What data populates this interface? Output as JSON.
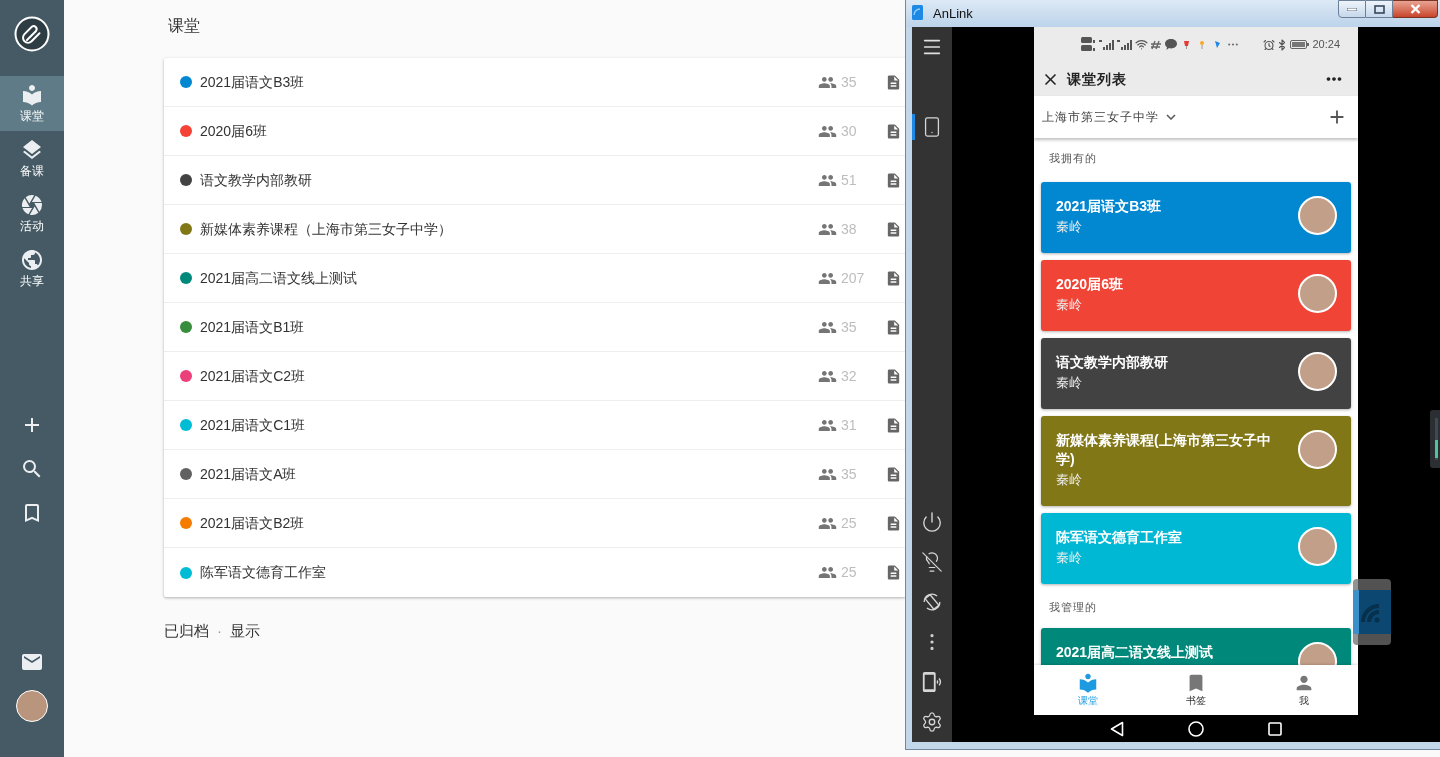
{
  "sidebar": {
    "items": [
      {
        "kind": "classes",
        "label": "课堂",
        "selected": true
      },
      {
        "kind": "lessons",
        "label": "备课",
        "selected": false
      },
      {
        "kind": "activities",
        "label": "活动",
        "selected": false
      },
      {
        "kind": "shared",
        "label": "共享",
        "selected": false
      }
    ]
  },
  "main": {
    "title": "课堂",
    "classes": [
      {
        "name": "2021届语文B3班",
        "color": "#0288d1",
        "members": "35"
      },
      {
        "name": "2020届6班",
        "color": "#f44336",
        "members": "30"
      },
      {
        "name": "语文教学内部教研",
        "color": "#424242",
        "members": "51"
      },
      {
        "name": "新媒体素养课程（上海市第三女子中学）",
        "color": "#827717",
        "members": "38"
      },
      {
        "name": "2021届高二语文线上测试",
        "color": "#00897b",
        "members": "207"
      },
      {
        "name": "2021届语文B1班",
        "color": "#388e3c",
        "members": "35"
      },
      {
        "name": "2021届语文C2班",
        "color": "#ec407a",
        "members": "32"
      },
      {
        "name": "2021届语文C1班",
        "color": "#00bcd4",
        "members": "31"
      },
      {
        "name": "2021届语文A班",
        "color": "#616161",
        "members": "35"
      },
      {
        "name": "2021届语文B2班",
        "color": "#f57c00",
        "members": "25"
      },
      {
        "name": "陈军语文德育工作室",
        "color": "#00bcd4",
        "members": "25"
      }
    ],
    "archived": {
      "label": "已归档",
      "separator": "·",
      "action": "显示"
    }
  },
  "window": {
    "title": "AnLink",
    "toolbar": {
      "views": [
        {
          "kind": "phone",
          "selected": true
        }
      ],
      "actions": [
        {
          "kind": "power"
        },
        {
          "kind": "light"
        },
        {
          "kind": "rotate"
        },
        {
          "kind": "more"
        },
        {
          "kind": "cast"
        },
        {
          "kind": "settings"
        }
      ]
    },
    "phone": {
      "status_bar": {
        "time": "20:24"
      },
      "app_bar": {
        "title": "课堂列表"
      },
      "school": "上海市第三女子中学",
      "sections": [
        {
          "label": "我拥有的",
          "classes": [
            {
              "name": "2021届语文B3班",
              "teacher": "秦岭",
              "color": "#0288d1"
            },
            {
              "name": "2020届6班",
              "teacher": "秦岭",
              "color": "#f04437"
            },
            {
              "name": "语文教学内部教研",
              "teacher": "秦岭",
              "color": "#424242"
            },
            {
              "name": "新媒体素养课程(上海市第三女子中学)",
              "teacher": "秦岭",
              "color": "#827717"
            },
            {
              "name": "陈军语文德育工作室",
              "teacher": "秦岭",
              "color": "#00b8d4"
            }
          ]
        },
        {
          "label": "我管理的",
          "classes": [
            {
              "name": "2021届高二语文线上测试",
              "color": "#00897b"
            }
          ]
        }
      ],
      "bottom_nav": [
        {
          "kind": "classes",
          "label": "课堂",
          "selected": true
        },
        {
          "kind": "bookmarks",
          "label": "书签",
          "selected": false
        },
        {
          "kind": "me",
          "label": "我",
          "selected": false
        }
      ]
    }
  }
}
